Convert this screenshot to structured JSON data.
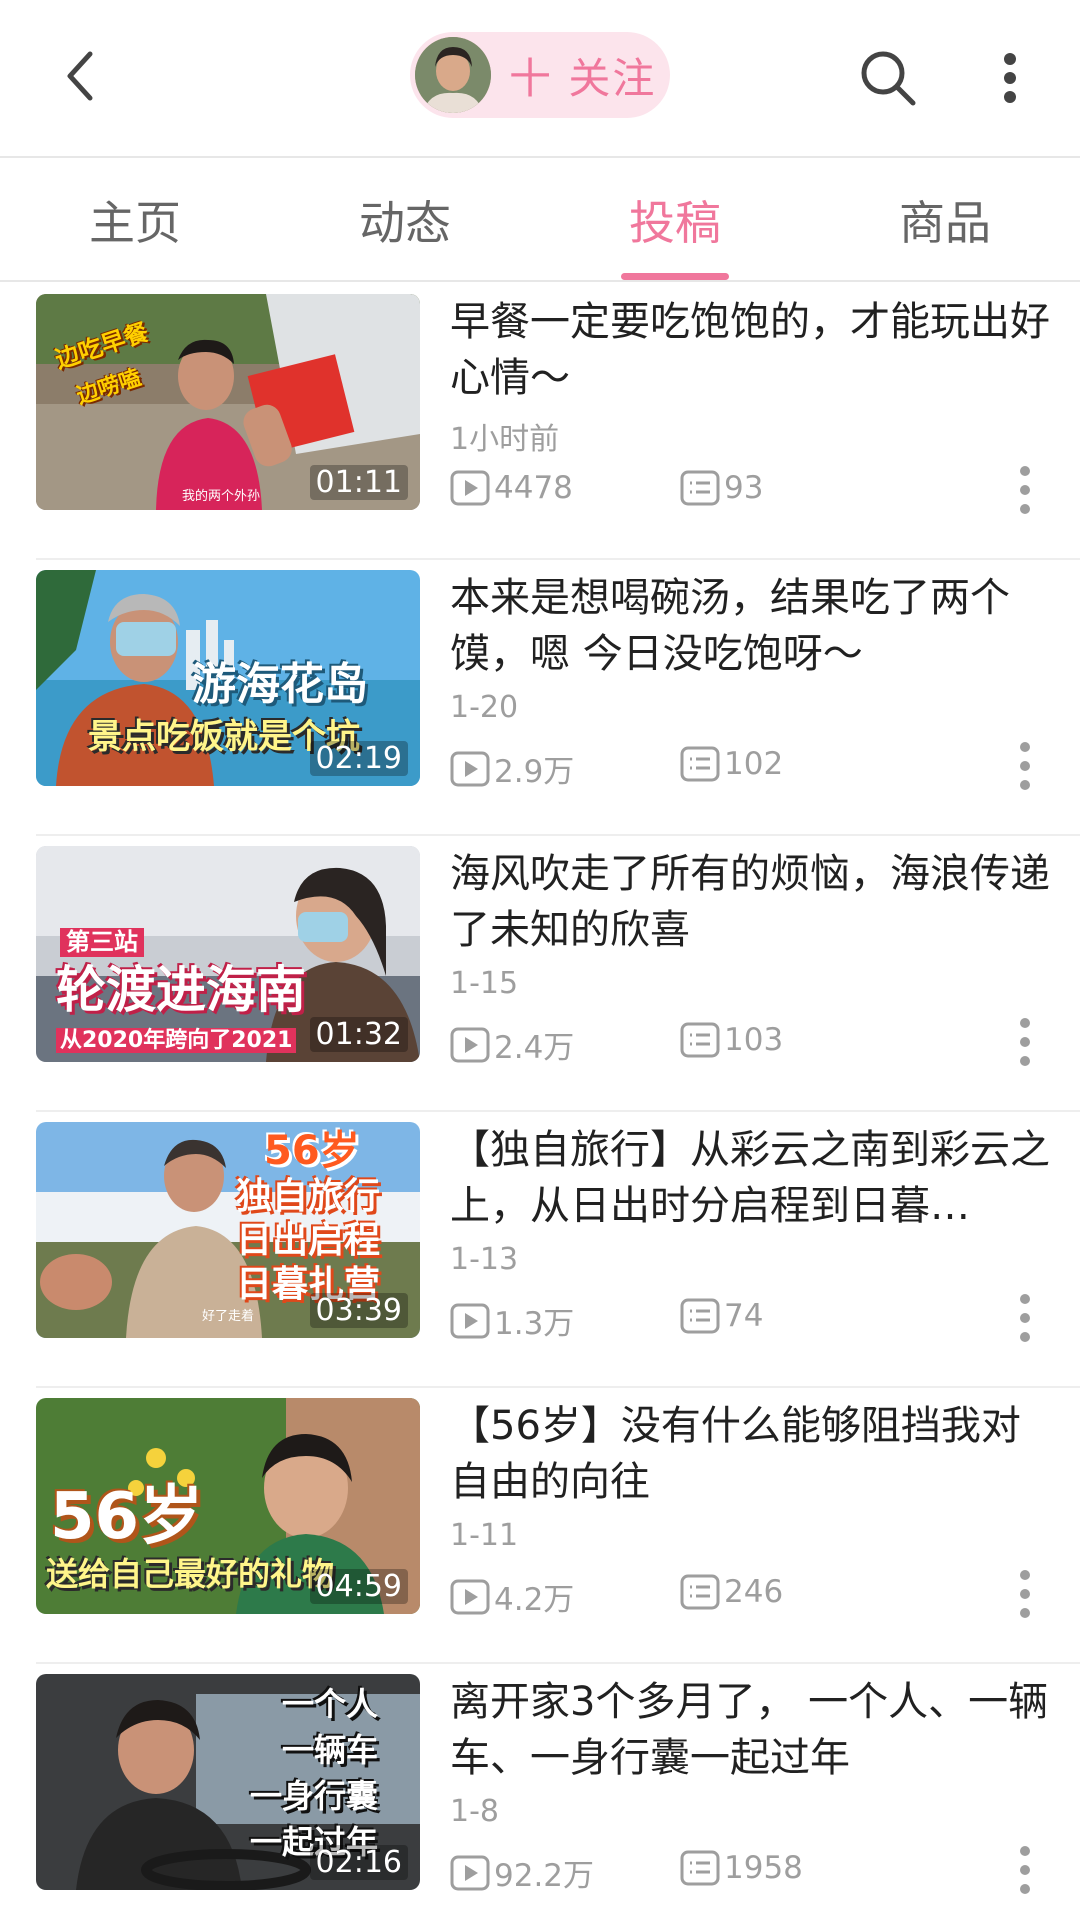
{
  "header": {
    "follow_label": "十 关注",
    "accent": "#f0779c",
    "pill_bg": "#fce4ec"
  },
  "tabs": [
    {
      "label": "主页",
      "active": false
    },
    {
      "label": "动态",
      "active": false
    },
    {
      "label": "投稿",
      "active": true
    },
    {
      "label": "商品",
      "active": false
    }
  ],
  "videos": [
    {
      "title": "早餐一定要吃饱饱的，才能玩出好心情～",
      "time": "1小时前",
      "duration": "01:11",
      "plays": "4478",
      "comments": "93",
      "thumb_text": [
        "边吃早餐",
        "边唠嗑"
      ],
      "thumb_caption": "我的两个外孙"
    },
    {
      "title": "本来是想喝碗汤，结果吃了两个馍，嗯 今日没吃饱呀～",
      "time": "1-20",
      "duration": "02:19",
      "plays": "2.9万",
      "comments": "102",
      "thumb_text": [
        "游海花岛",
        "景点吃饭就是个坑"
      ]
    },
    {
      "title": "海风吹走了所有的烦恼，海浪传递了未知的欣喜",
      "time": "1-15",
      "duration": "01:32",
      "plays": "2.4万",
      "comments": "103",
      "thumb_text": [
        "第三站",
        "轮渡进海南",
        "从2020年跨向了2021"
      ]
    },
    {
      "title": "【独自旅行】从彩云之南到彩云之上，从日出时分启程到日暮…",
      "time": "1-13",
      "duration": "03:39",
      "plays": "1.3万",
      "comments": "74",
      "thumb_text": [
        "56岁",
        "独自旅行",
        "日出启程",
        "日暮扎营"
      ],
      "thumb_caption": "好了走着"
    },
    {
      "title": "【56岁】没有什么能够阻挡我对自由的向往",
      "time": "1-11",
      "duration": "04:59",
      "plays": "4.2万",
      "comments": "246",
      "thumb_text": [
        "56岁",
        "送给自己最好的礼物"
      ]
    },
    {
      "title": "离开家3个多月了， 一个人、一辆车、一身行囊一起过年",
      "time": "1-8",
      "duration": "02:16",
      "plays": "92.2万",
      "comments": "1958",
      "thumb_text": [
        "一个人",
        "一辆车",
        "一身行囊",
        "一起过年"
      ]
    }
  ],
  "icons": {
    "back": "chevron-left-icon",
    "search": "search-icon",
    "more": "more-vertical-icon",
    "play_count": "play-icon",
    "comment_count": "comment-icon"
  }
}
